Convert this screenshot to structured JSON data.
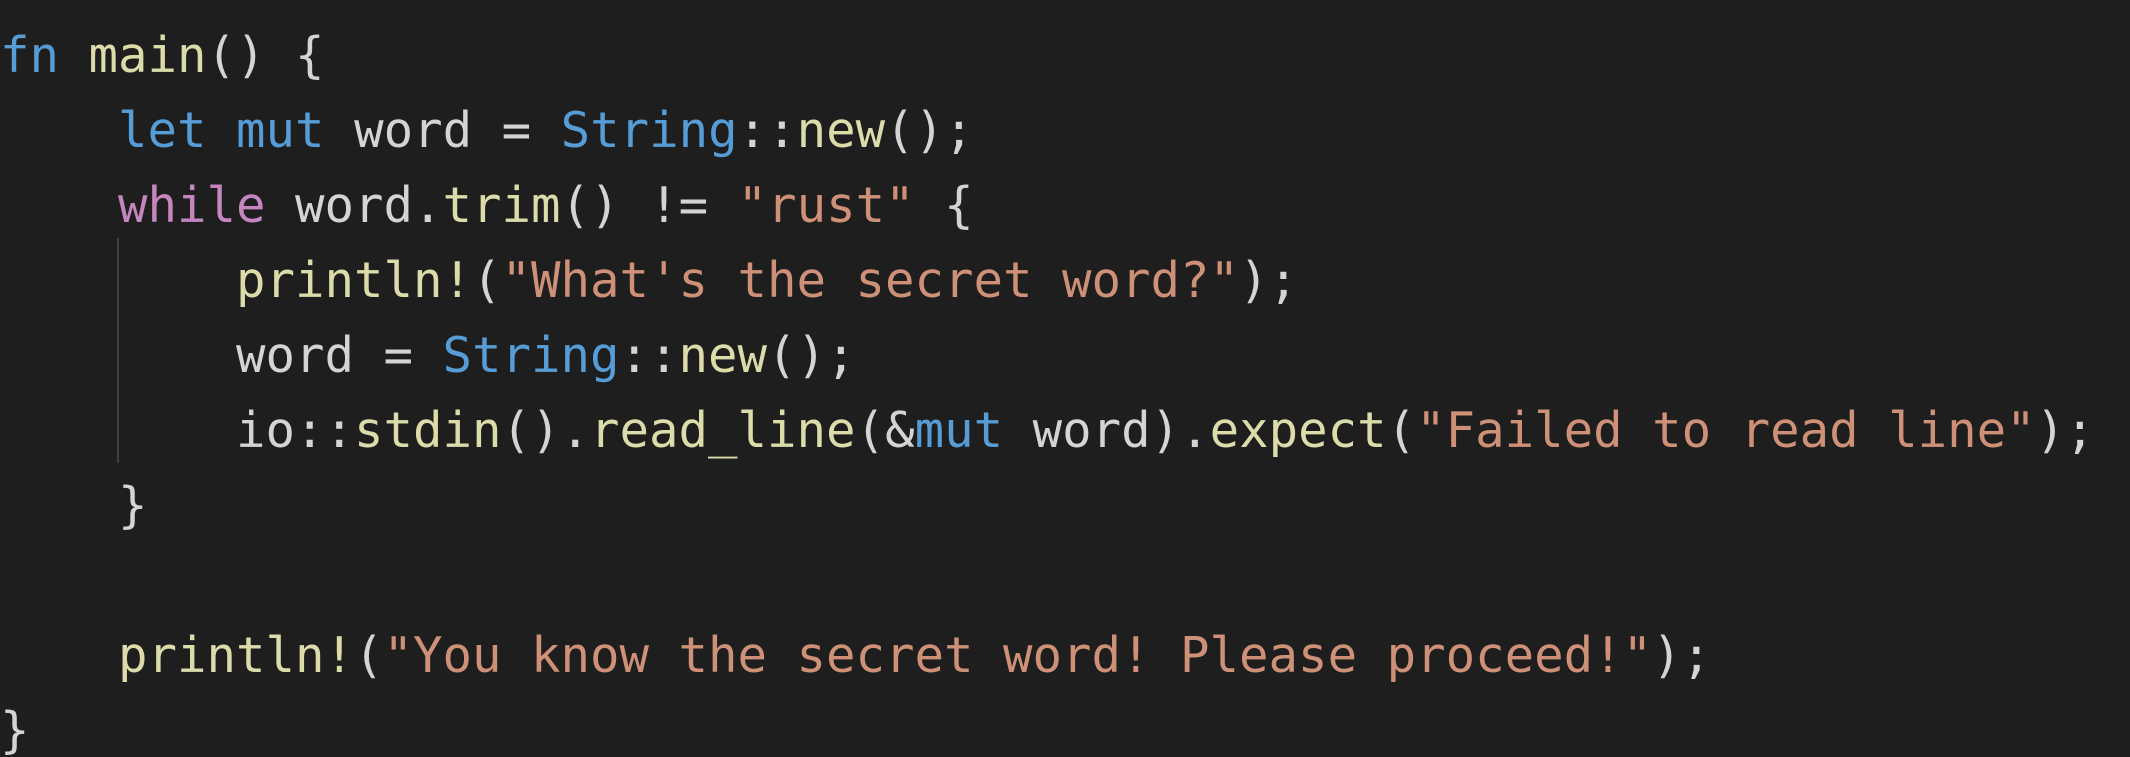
{
  "colors": {
    "background": "#1e1e1e",
    "keyword": "#569cd6",
    "control": "#c586c0",
    "function": "#dcdcaa",
    "type": "#569cd6",
    "string": "#ce9178",
    "text": "#d4d4d4",
    "indent_guide": "#404040"
  },
  "code": {
    "lines": [
      [
        {
          "t": "fn",
          "c": "keyword"
        },
        {
          "t": " ",
          "c": "punct"
        },
        {
          "t": "main",
          "c": "function"
        },
        {
          "t": "() {",
          "c": "punct"
        }
      ],
      [
        {
          "t": "    ",
          "c": "punct"
        },
        {
          "t": "let",
          "c": "keyword"
        },
        {
          "t": " ",
          "c": "punct"
        },
        {
          "t": "mut",
          "c": "keyword"
        },
        {
          "t": " word = ",
          "c": "ident"
        },
        {
          "t": "String",
          "c": "type-blue"
        },
        {
          "t": "::",
          "c": "punct"
        },
        {
          "t": "new",
          "c": "function"
        },
        {
          "t": "();",
          "c": "punct"
        }
      ],
      [
        {
          "t": "    ",
          "c": "punct"
        },
        {
          "t": "while",
          "c": "control"
        },
        {
          "t": " word.",
          "c": "ident"
        },
        {
          "t": "trim",
          "c": "function"
        },
        {
          "t": "() != ",
          "c": "punct"
        },
        {
          "t": "\"rust\"",
          "c": "string"
        },
        {
          "t": " {",
          "c": "punct"
        }
      ],
      [
        {
          "t": "        ",
          "c": "punct"
        },
        {
          "t": "println!",
          "c": "function"
        },
        {
          "t": "(",
          "c": "punct"
        },
        {
          "t": "\"What's the secret word?\"",
          "c": "string"
        },
        {
          "t": ");",
          "c": "punct"
        }
      ],
      [
        {
          "t": "        word = ",
          "c": "ident"
        },
        {
          "t": "String",
          "c": "type-blue"
        },
        {
          "t": "::",
          "c": "punct"
        },
        {
          "t": "new",
          "c": "function"
        },
        {
          "t": "();",
          "c": "punct"
        }
      ],
      [
        {
          "t": "        io::",
          "c": "ident"
        },
        {
          "t": "stdin",
          "c": "function"
        },
        {
          "t": "().",
          "c": "punct"
        },
        {
          "t": "read_line",
          "c": "function"
        },
        {
          "t": "(&",
          "c": "punct"
        },
        {
          "t": "mut",
          "c": "keyword"
        },
        {
          "t": " word).",
          "c": "ident"
        },
        {
          "t": "expect",
          "c": "function"
        },
        {
          "t": "(",
          "c": "punct"
        },
        {
          "t": "\"Failed to read line\"",
          "c": "string"
        },
        {
          "t": ");",
          "c": "punct"
        }
      ],
      [
        {
          "t": "    }",
          "c": "punct"
        }
      ],
      [
        {
          "t": "",
          "c": "punct"
        }
      ],
      [
        {
          "t": "    ",
          "c": "punct"
        },
        {
          "t": "println!",
          "c": "function"
        },
        {
          "t": "(",
          "c": "punct"
        },
        {
          "t": "\"You know the secret word! Please proceed!\"",
          "c": "string"
        },
        {
          "t": ");",
          "c": "punct"
        }
      ],
      [
        {
          "t": "}",
          "c": "punct"
        }
      ]
    ]
  }
}
